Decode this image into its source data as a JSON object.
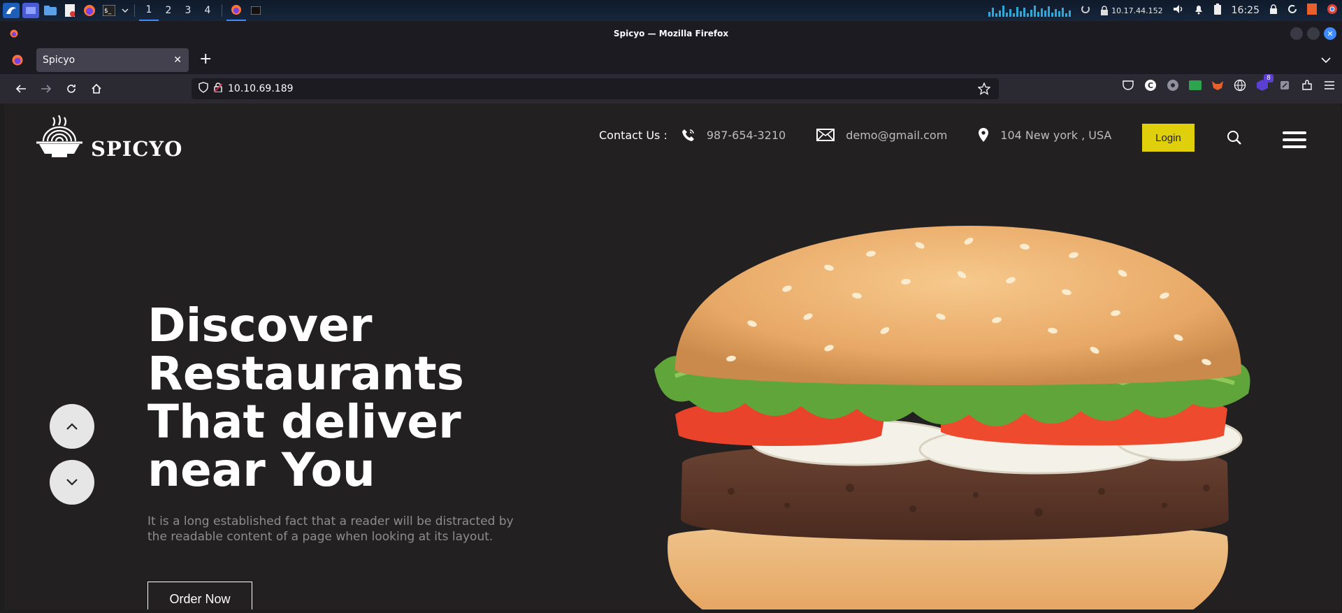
{
  "taskbar": {
    "workspaces": [
      "1",
      "2",
      "3",
      "4"
    ],
    "ip": "10.17.44.152",
    "clock": "16:25",
    "graph_levels": [
      0.4,
      0.7,
      0.3,
      0.5,
      0.9,
      0.35,
      0.6,
      0.3,
      0.8,
      0.45,
      0.7,
      0.3,
      0.55,
      0.9,
      0.4,
      0.65,
      0.5,
      0.85,
      0.35,
      0.6,
      0.45,
      0.7,
      0.3,
      0.5
    ]
  },
  "window": {
    "title": "Spicyo — Mozilla Firefox"
  },
  "browser": {
    "tab_title": "Spicyo",
    "url": "10.10.69.189",
    "extension_badge": "8"
  },
  "site": {
    "brand": "SPICYO",
    "contact_label": "Contact Us :",
    "phone": "987-654-3210",
    "email": "demo@gmail.com",
    "address": "104 New york , USA",
    "login_label": "Login",
    "hero_title_lines": [
      "Discover",
      "Restaurants",
      "That deliver",
      "near You"
    ],
    "hero_description": "It is a long established fact that a reader will be distracted by the readable content of a page when looking at its layout.",
    "order_label": "Order Now",
    "colors": {
      "page_bg": "#222021",
      "login_bg": "#e0d00c",
      "text_muted": "#8d8d8d"
    }
  }
}
